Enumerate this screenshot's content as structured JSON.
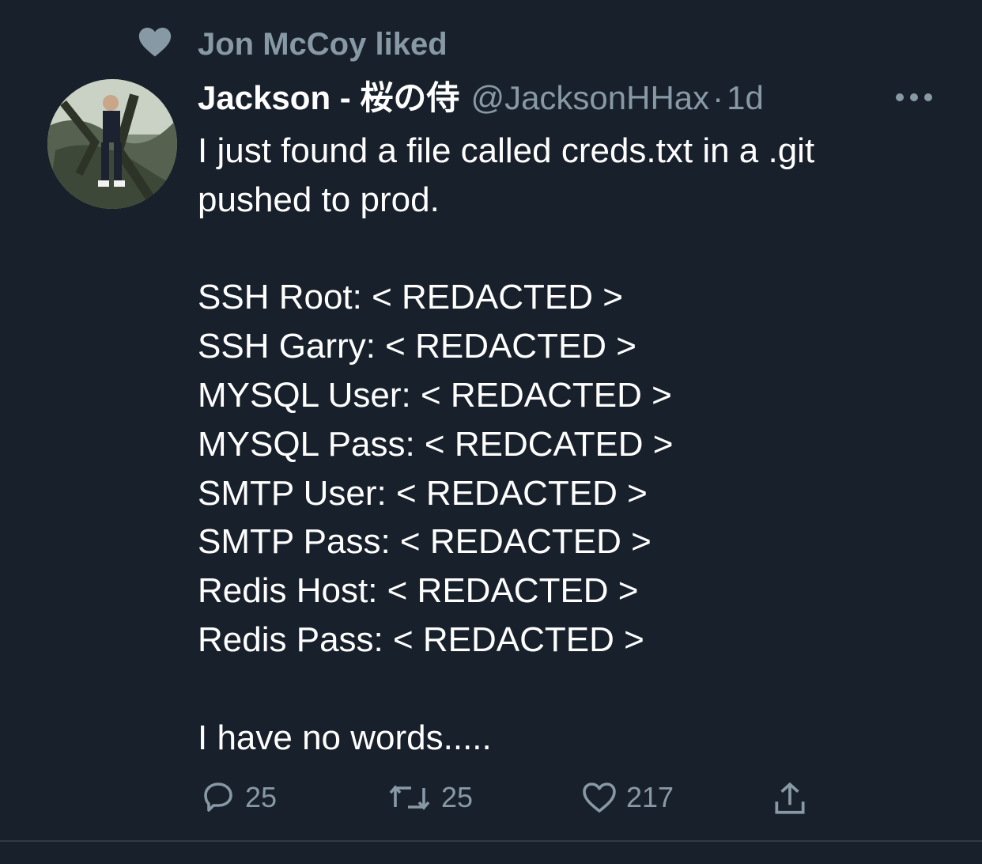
{
  "social_context": {
    "text": "Jon McCoy liked",
    "icon": "heart-icon"
  },
  "tweet": {
    "author_name": "Jackson - 桜の侍",
    "handle": "@JacksonHHax",
    "separator": "·",
    "timestamp": "1d",
    "lines": [
      "I just found a file called creds.txt in a .git",
      "pushed to prod.",
      "",
      "SSH Root: < REDACTED >",
      "SSH Garry: < REDACTED >",
      "MYSQL User: < REDACTED >",
      "MYSQL Pass: < REDCATED >",
      "SMTP User: < REDACTED >",
      "SMTP Pass: < REDACTED >",
      "Redis Host: < REDACTED >",
      "Redis Pass: < REDACTED >",
      "",
      "I have no words....."
    ]
  },
  "actions": {
    "reply_count": "25",
    "retweet_count": "25",
    "like_count": "217"
  },
  "colors": {
    "background": "#18202b",
    "muted": "#8899a6",
    "text": "#ffffff"
  }
}
